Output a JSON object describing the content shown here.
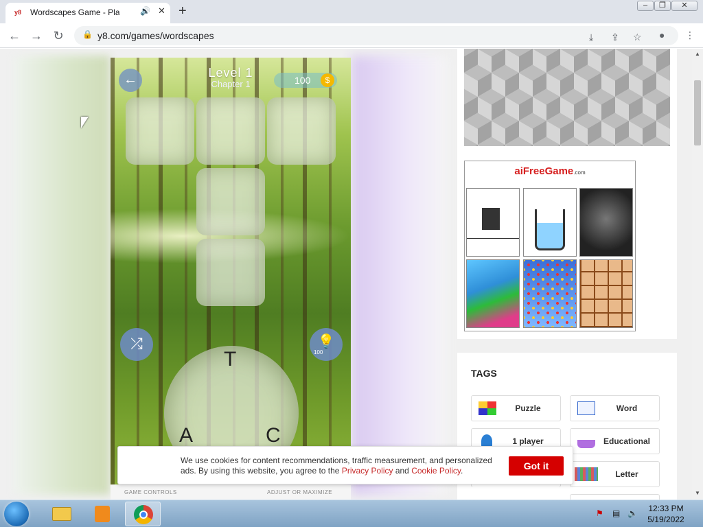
{
  "browser": {
    "tab_title": "Wordscapes Game - Play on",
    "tab_favicon": "y8",
    "url": "y8.com/games/wordscapes"
  },
  "game": {
    "level": "Level 1",
    "chapter": "Chapter 1",
    "coins": "100",
    "hint_cost": "100",
    "letters": [
      "T",
      "A",
      "C"
    ]
  },
  "game_controls": {
    "left_label": "GAME CONTROLS",
    "right_label": "ADJUST OR MAXIMIZE"
  },
  "ad": {
    "logo_text": "aiFreeGame",
    "logo_domain": ".com"
  },
  "tags": {
    "title": "TAGS",
    "items": [
      {
        "label": "Puzzle"
      },
      {
        "label": "Word"
      },
      {
        "label": "1 player"
      },
      {
        "label": "Educational"
      },
      {
        "label": ""
      },
      {
        "label": "Letter"
      }
    ]
  },
  "cookie": {
    "text_before": "We use cookies for content recommendations, traffic measurement, and personalized ads. By using this website, you agree to the ",
    "privacy_link": "Privacy Policy",
    "and": " and ",
    "cookie_link": "Cookie Policy",
    "period": ".",
    "button": "Got it"
  },
  "taskbar": {
    "time": "12:33 PM",
    "date": "5/19/2022"
  },
  "colors": {
    "accent_red": "#d50000",
    "link_red": "#c62828"
  }
}
